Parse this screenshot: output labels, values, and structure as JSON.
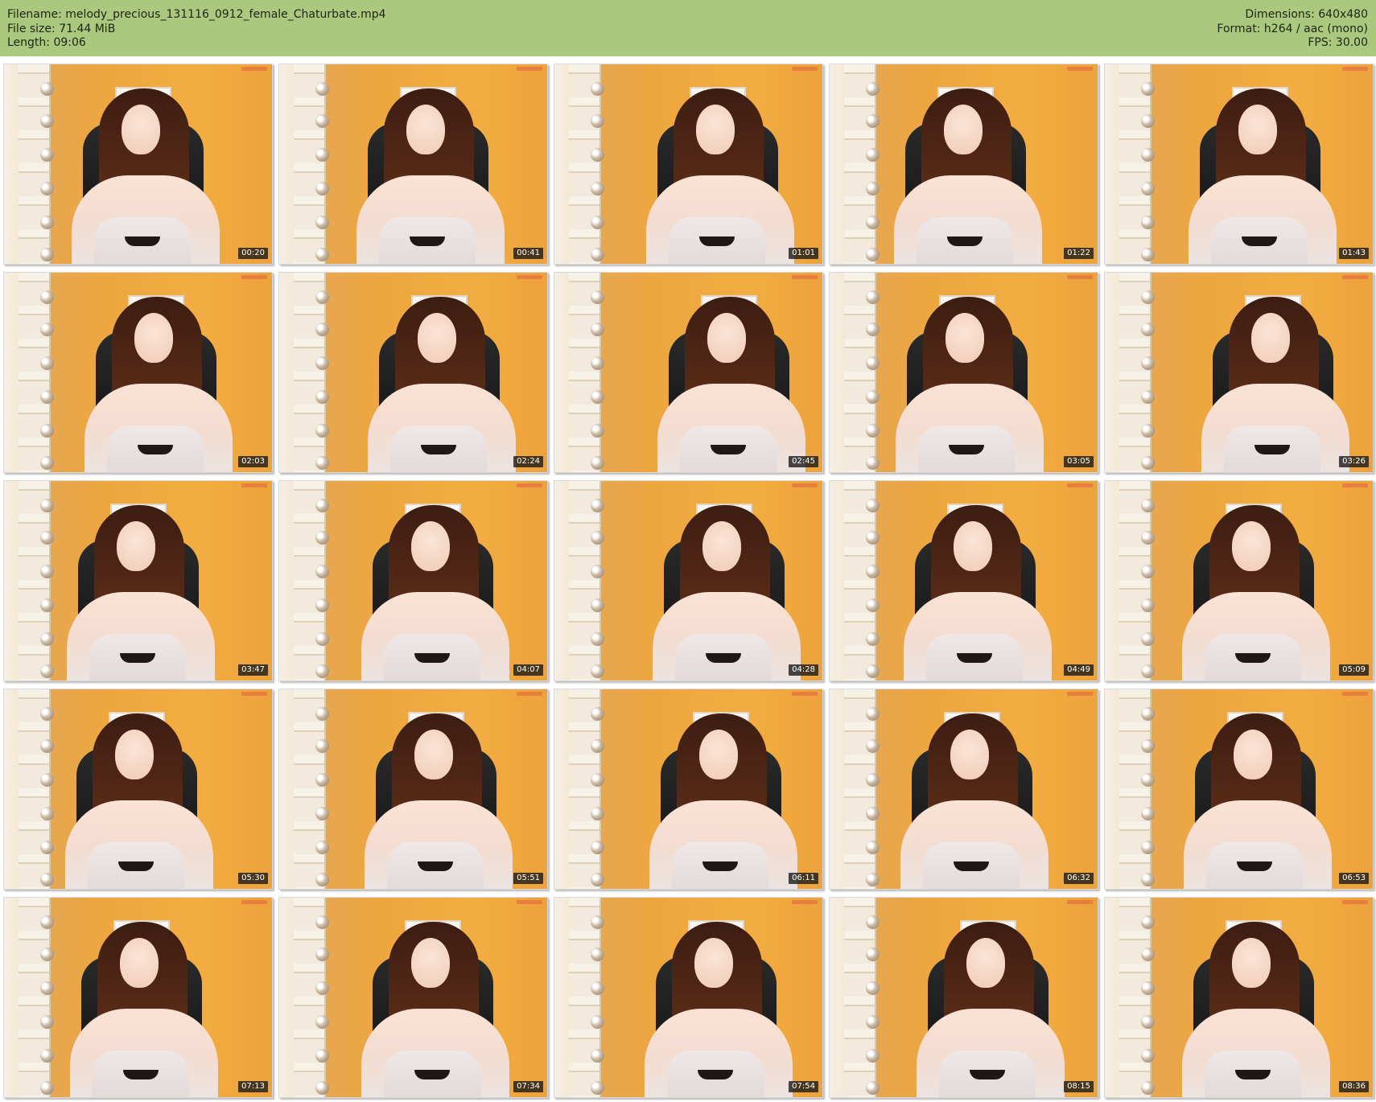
{
  "header": {
    "filename": "Filename: melody_precious_131116_0912_female_Chaturbate.mp4",
    "filesize": "File size: 71.44 MiB",
    "length": "Length: 09:06",
    "dimensions": "Dimensions: 640x480",
    "format": "Format: h264 / aac (mono)",
    "fps": "FPS: 30.00"
  },
  "colors": {
    "header_background": "#abc97e",
    "wall": "#eea63e",
    "timestamp_background": "#161616"
  },
  "thumbnails": [
    {
      "timestamp": "00:20"
    },
    {
      "timestamp": "00:41"
    },
    {
      "timestamp": "01:01"
    },
    {
      "timestamp": "01:22"
    },
    {
      "timestamp": "01:43"
    },
    {
      "timestamp": "02:03"
    },
    {
      "timestamp": "02:24"
    },
    {
      "timestamp": "02:45"
    },
    {
      "timestamp": "03:05"
    },
    {
      "timestamp": "03:26"
    },
    {
      "timestamp": "03:47"
    },
    {
      "timestamp": "04:07"
    },
    {
      "timestamp": "04:28"
    },
    {
      "timestamp": "04:49"
    },
    {
      "timestamp": "05:09"
    },
    {
      "timestamp": "05:30"
    },
    {
      "timestamp": "05:51"
    },
    {
      "timestamp": "06:11"
    },
    {
      "timestamp": "06:32"
    },
    {
      "timestamp": "06:53"
    },
    {
      "timestamp": "07:13"
    },
    {
      "timestamp": "07:34"
    },
    {
      "timestamp": "07:54"
    },
    {
      "timestamp": "08:15"
    },
    {
      "timestamp": "08:36"
    }
  ]
}
